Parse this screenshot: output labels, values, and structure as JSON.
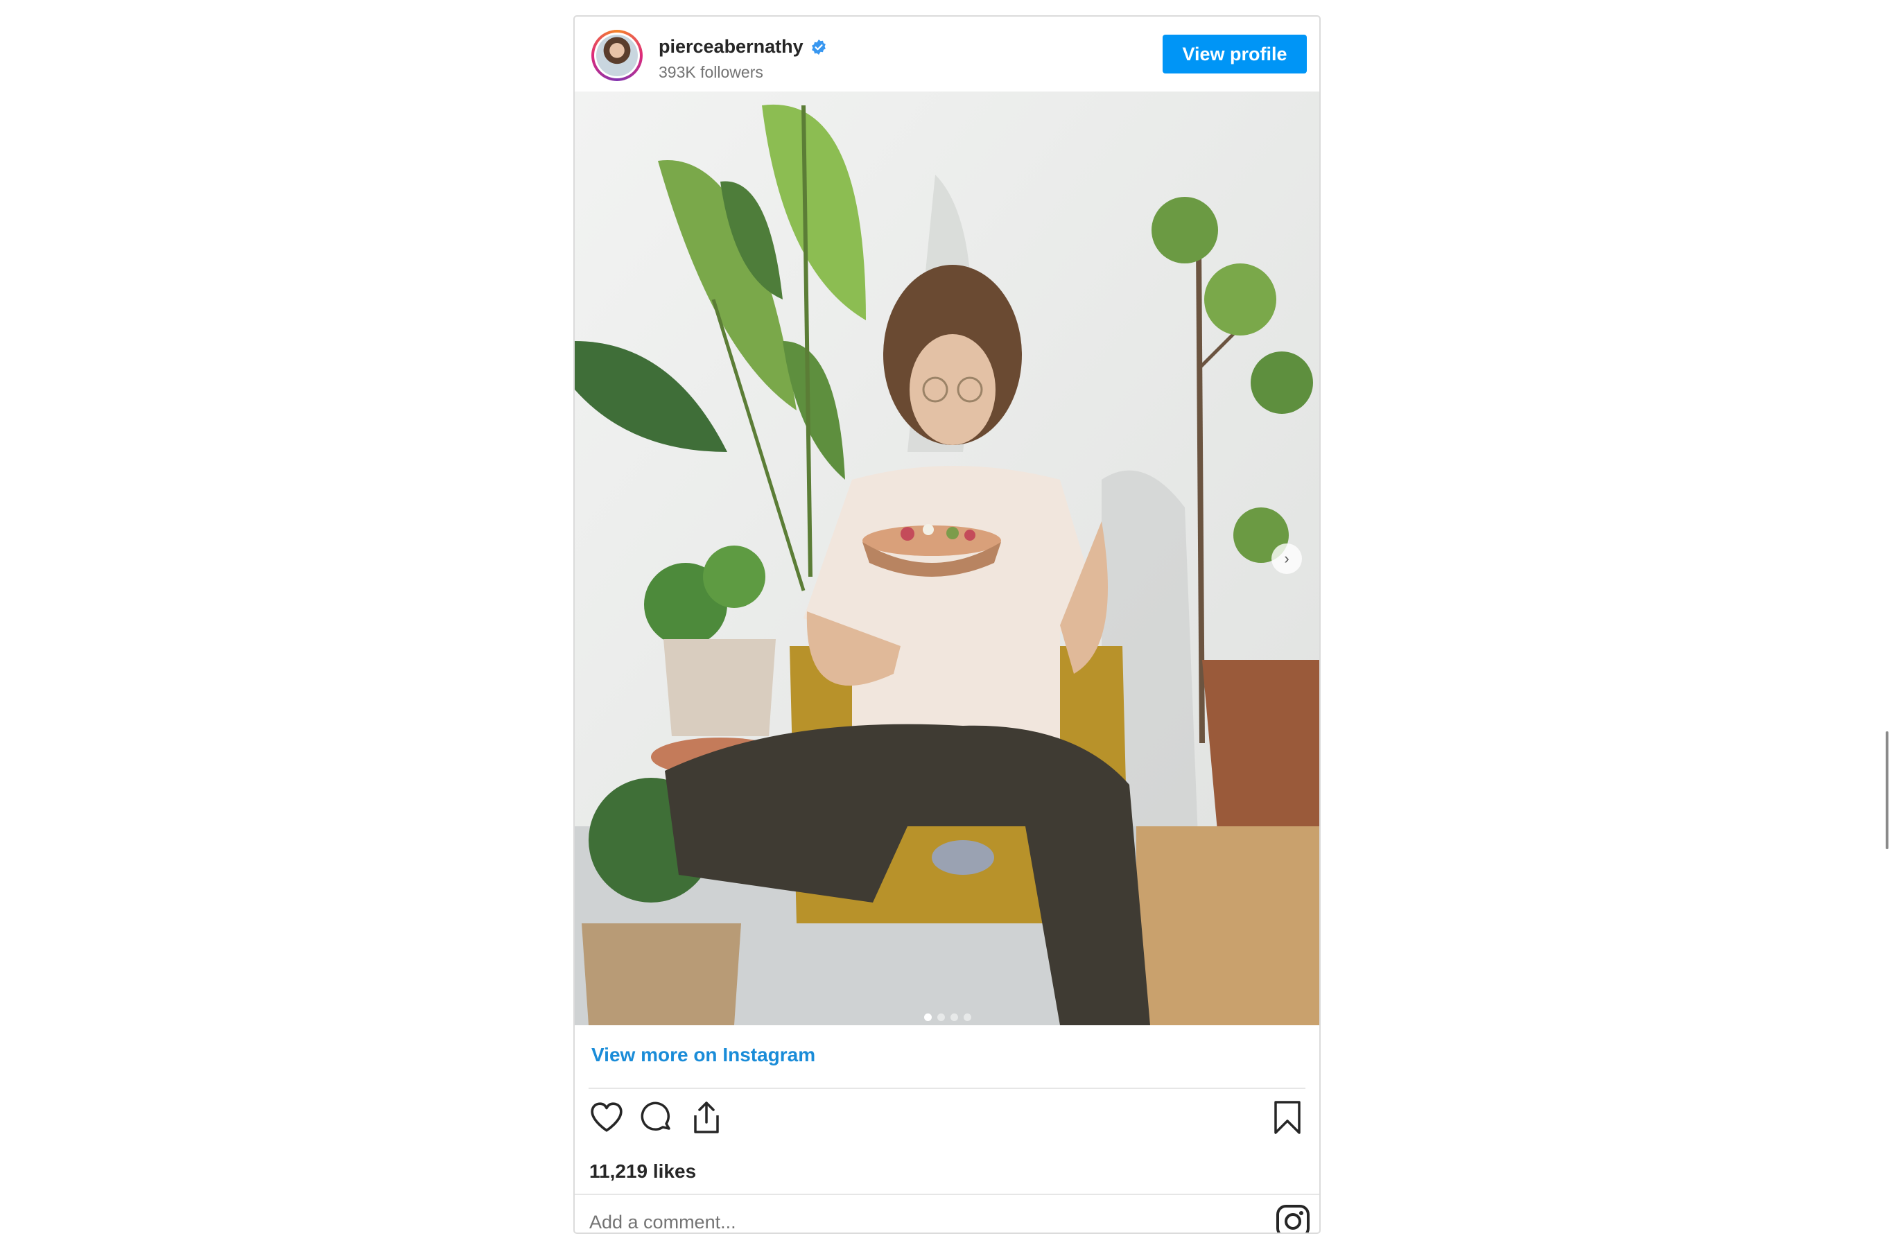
{
  "header": {
    "username": "pierceabernathy",
    "followers": "393K followers",
    "view_profile_label": "View profile"
  },
  "post": {
    "carousel_total": 4,
    "carousel_active": 1
  },
  "links": {
    "view_more": "View more on Instagram"
  },
  "stats": {
    "likes": "11,219 likes"
  },
  "comment": {
    "placeholder": "Add a comment..."
  },
  "icons": {
    "verified": "verified-badge-icon",
    "like": "heart-icon",
    "comment": "comment-icon",
    "share": "share-icon",
    "save": "bookmark-icon",
    "logo": "instagram-icon",
    "next": "chevron-right-icon"
  },
  "colors": {
    "accent": "#0095f6",
    "link": "#1a8cd8",
    "text": "#262626",
    "muted": "#737373"
  }
}
